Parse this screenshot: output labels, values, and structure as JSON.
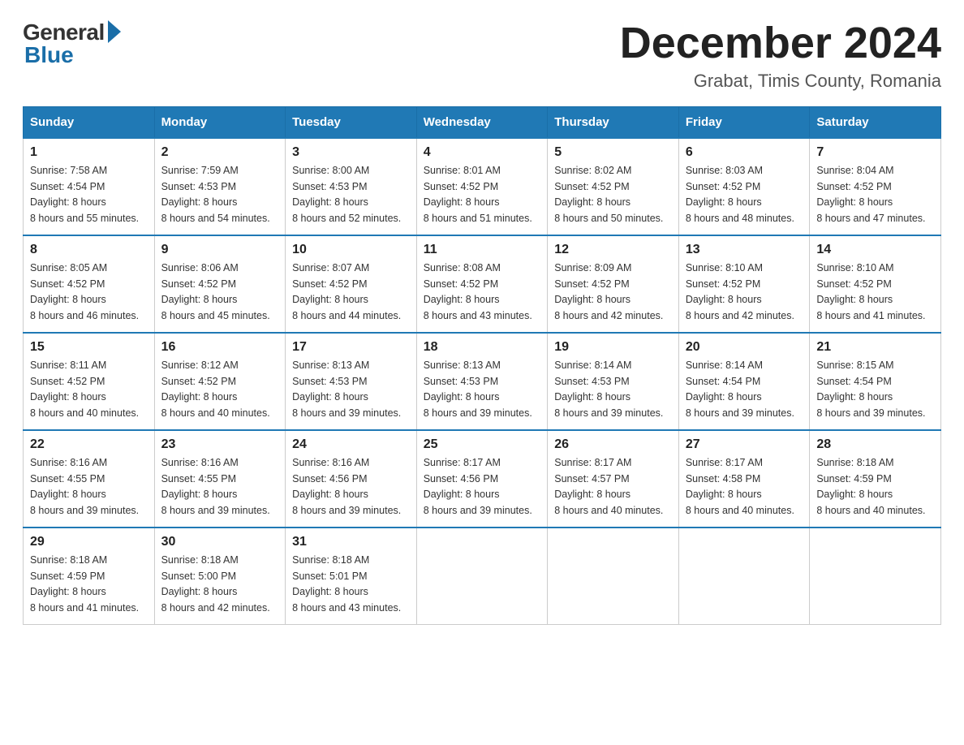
{
  "logo": {
    "general": "General",
    "blue": "Blue"
  },
  "header": {
    "month_year": "December 2024",
    "location": "Grabat, Timis County, Romania"
  },
  "weekdays": [
    "Sunday",
    "Monday",
    "Tuesday",
    "Wednesday",
    "Thursday",
    "Friday",
    "Saturday"
  ],
  "weeks": [
    [
      {
        "day": "1",
        "sunrise": "7:58 AM",
        "sunset": "4:54 PM",
        "daylight": "8 hours and 55 minutes."
      },
      {
        "day": "2",
        "sunrise": "7:59 AM",
        "sunset": "4:53 PM",
        "daylight": "8 hours and 54 minutes."
      },
      {
        "day": "3",
        "sunrise": "8:00 AM",
        "sunset": "4:53 PM",
        "daylight": "8 hours and 52 minutes."
      },
      {
        "day": "4",
        "sunrise": "8:01 AM",
        "sunset": "4:52 PM",
        "daylight": "8 hours and 51 minutes."
      },
      {
        "day": "5",
        "sunrise": "8:02 AM",
        "sunset": "4:52 PM",
        "daylight": "8 hours and 50 minutes."
      },
      {
        "day": "6",
        "sunrise": "8:03 AM",
        "sunset": "4:52 PM",
        "daylight": "8 hours and 48 minutes."
      },
      {
        "day": "7",
        "sunrise": "8:04 AM",
        "sunset": "4:52 PM",
        "daylight": "8 hours and 47 minutes."
      }
    ],
    [
      {
        "day": "8",
        "sunrise": "8:05 AM",
        "sunset": "4:52 PM",
        "daylight": "8 hours and 46 minutes."
      },
      {
        "day": "9",
        "sunrise": "8:06 AM",
        "sunset": "4:52 PM",
        "daylight": "8 hours and 45 minutes."
      },
      {
        "day": "10",
        "sunrise": "8:07 AM",
        "sunset": "4:52 PM",
        "daylight": "8 hours and 44 minutes."
      },
      {
        "day": "11",
        "sunrise": "8:08 AM",
        "sunset": "4:52 PM",
        "daylight": "8 hours and 43 minutes."
      },
      {
        "day": "12",
        "sunrise": "8:09 AM",
        "sunset": "4:52 PM",
        "daylight": "8 hours and 42 minutes."
      },
      {
        "day": "13",
        "sunrise": "8:10 AM",
        "sunset": "4:52 PM",
        "daylight": "8 hours and 42 minutes."
      },
      {
        "day": "14",
        "sunrise": "8:10 AM",
        "sunset": "4:52 PM",
        "daylight": "8 hours and 41 minutes."
      }
    ],
    [
      {
        "day": "15",
        "sunrise": "8:11 AM",
        "sunset": "4:52 PM",
        "daylight": "8 hours and 40 minutes."
      },
      {
        "day": "16",
        "sunrise": "8:12 AM",
        "sunset": "4:52 PM",
        "daylight": "8 hours and 40 minutes."
      },
      {
        "day": "17",
        "sunrise": "8:13 AM",
        "sunset": "4:53 PM",
        "daylight": "8 hours and 39 minutes."
      },
      {
        "day": "18",
        "sunrise": "8:13 AM",
        "sunset": "4:53 PM",
        "daylight": "8 hours and 39 minutes."
      },
      {
        "day": "19",
        "sunrise": "8:14 AM",
        "sunset": "4:53 PM",
        "daylight": "8 hours and 39 minutes."
      },
      {
        "day": "20",
        "sunrise": "8:14 AM",
        "sunset": "4:54 PM",
        "daylight": "8 hours and 39 minutes."
      },
      {
        "day": "21",
        "sunrise": "8:15 AM",
        "sunset": "4:54 PM",
        "daylight": "8 hours and 39 minutes."
      }
    ],
    [
      {
        "day": "22",
        "sunrise": "8:16 AM",
        "sunset": "4:55 PM",
        "daylight": "8 hours and 39 minutes."
      },
      {
        "day": "23",
        "sunrise": "8:16 AM",
        "sunset": "4:55 PM",
        "daylight": "8 hours and 39 minutes."
      },
      {
        "day": "24",
        "sunrise": "8:16 AM",
        "sunset": "4:56 PM",
        "daylight": "8 hours and 39 minutes."
      },
      {
        "day": "25",
        "sunrise": "8:17 AM",
        "sunset": "4:56 PM",
        "daylight": "8 hours and 39 minutes."
      },
      {
        "day": "26",
        "sunrise": "8:17 AM",
        "sunset": "4:57 PM",
        "daylight": "8 hours and 40 minutes."
      },
      {
        "day": "27",
        "sunrise": "8:17 AM",
        "sunset": "4:58 PM",
        "daylight": "8 hours and 40 minutes."
      },
      {
        "day": "28",
        "sunrise": "8:18 AM",
        "sunset": "4:59 PM",
        "daylight": "8 hours and 40 minutes."
      }
    ],
    [
      {
        "day": "29",
        "sunrise": "8:18 AM",
        "sunset": "4:59 PM",
        "daylight": "8 hours and 41 minutes."
      },
      {
        "day": "30",
        "sunrise": "8:18 AM",
        "sunset": "5:00 PM",
        "daylight": "8 hours and 42 minutes."
      },
      {
        "day": "31",
        "sunrise": "8:18 AM",
        "sunset": "5:01 PM",
        "daylight": "8 hours and 43 minutes."
      },
      null,
      null,
      null,
      null
    ]
  ],
  "labels": {
    "sunrise": "Sunrise:",
    "sunset": "Sunset:",
    "daylight": "Daylight: 8 hours"
  }
}
